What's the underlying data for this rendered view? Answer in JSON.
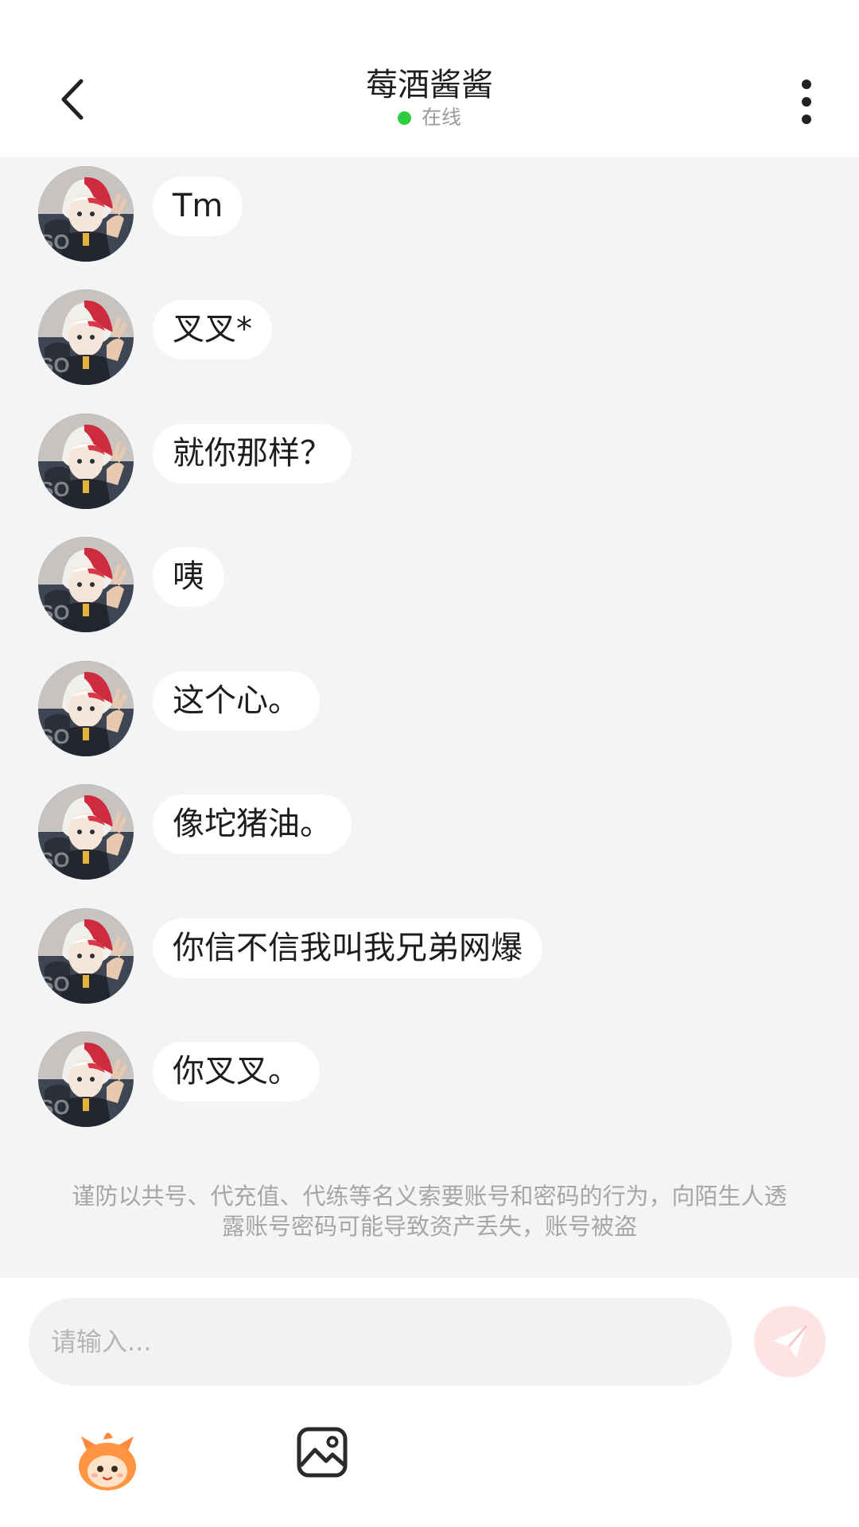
{
  "header": {
    "title": "莓酒酱酱",
    "status_text": "在线",
    "status_color": "#2ecc40",
    "back_icon": "chevron-left-icon",
    "more_icon": "more-vertical-icon"
  },
  "messages": [
    {
      "text": "Tm"
    },
    {
      "text": "叉叉*"
    },
    {
      "text": "就你那样？"
    },
    {
      "text": "咦"
    },
    {
      "text": "这个心。"
    },
    {
      "text": "像坨猪油。"
    },
    {
      "text": "你信不信我叫我兄弟网爆"
    },
    {
      "text": "你叉叉。"
    }
  ],
  "notice": "谨防以共号、代充值、代练等名义索要账号和密码的行为，向陌生人透露账号密码可能导致资产丢失，账号被盗",
  "composer": {
    "placeholder": "请输入...",
    "send_icon": "send-icon",
    "send_color": "#fde4e4",
    "emoji_icon": "emoji-mascot-icon",
    "image_icon": "image-icon"
  },
  "colors": {
    "chat_background": "#f3f4f6",
    "bubble": "#ffffff"
  }
}
